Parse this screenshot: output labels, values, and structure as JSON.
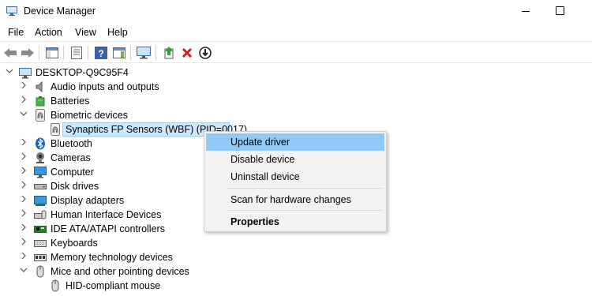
{
  "window": {
    "title": "Device Manager"
  },
  "menu": [
    "File",
    "Action",
    "View",
    "Help"
  ],
  "toolbar_icons": [
    "back-arrow-icon",
    "forward-arrow-icon",
    "show-hide-tree-icon",
    "properties-icon",
    "help-icon",
    "action-pane-icon",
    "monitor-icon",
    "update-driver-icon",
    "uninstall-icon",
    "disable-icon"
  ],
  "tree": {
    "root": "DESKTOP-Q9C95F4",
    "items": [
      {
        "label": "Audio inputs and outputs",
        "icon": "speaker-icon",
        "expanded": false
      },
      {
        "label": "Batteries",
        "icon": "battery-icon",
        "expanded": false
      },
      {
        "label": "Biometric devices",
        "icon": "fingerprint-icon",
        "expanded": true
      },
      {
        "label": "Synaptics FP Sensors (WBF) (PID=0017)",
        "icon": "fingerprint-icon",
        "child": true,
        "selected": true
      },
      {
        "label": "Bluetooth",
        "icon": "bluetooth-icon",
        "expanded": false
      },
      {
        "label": "Cameras",
        "icon": "camera-icon",
        "expanded": false
      },
      {
        "label": "Computer",
        "icon": "computer-icon",
        "expanded": false
      },
      {
        "label": "Disk drives",
        "icon": "disk-drive-icon",
        "expanded": false
      },
      {
        "label": "Display adapters",
        "icon": "display-adapter-icon",
        "expanded": false
      },
      {
        "label": "Human Interface Devices",
        "icon": "hid-icon",
        "expanded": false
      },
      {
        "label": "IDE ATA/ATAPI controllers",
        "icon": "ide-controller-icon",
        "expanded": false
      },
      {
        "label": "Keyboards",
        "icon": "keyboard-icon",
        "expanded": false
      },
      {
        "label": "Memory technology devices",
        "icon": "memory-icon",
        "expanded": false
      },
      {
        "label": "Mice and other pointing devices",
        "icon": "mouse-icon",
        "expanded": true
      },
      {
        "label": "HID-compliant mouse",
        "icon": "mouse-icon",
        "child": true
      }
    ]
  },
  "context_menu": {
    "items": [
      {
        "label": "Update driver",
        "highlighted": true
      },
      {
        "label": "Disable device"
      },
      {
        "label": "Uninstall device"
      },
      {
        "label": "Scan for hardware changes"
      },
      {
        "label": "Properties",
        "bold": true
      }
    ]
  },
  "colors": {
    "selection": "#cce8ff",
    "menu_highlight": "#91c9f7",
    "menu_bg": "#f2f2f2"
  }
}
